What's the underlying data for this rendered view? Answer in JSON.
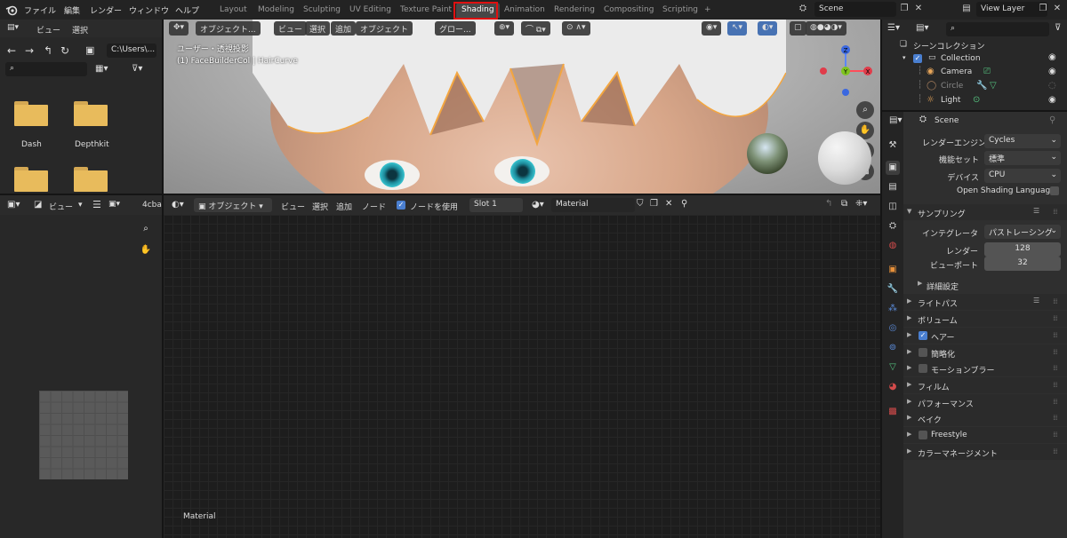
{
  "topbar": {
    "menus": [
      "ファイル",
      "編集",
      "レンダー",
      "ウィンドウ",
      "ヘルプ"
    ],
    "workspaces": [
      "Layout",
      "Modeling",
      "Sculpting",
      "UV Editing",
      "Texture Paint",
      "Shading",
      "Animation",
      "Rendering",
      "Compositing",
      "Scripting",
      "+"
    ],
    "active_workspace": "Shading",
    "scene": "Scene",
    "view_layer": "View Layer"
  },
  "filebrowser": {
    "menus": [
      "ビュー",
      "選択"
    ],
    "path": "C:\\Users\\...",
    "folders": [
      "Dash",
      "Depthkit",
      "",
      ""
    ]
  },
  "viewport": {
    "mode": "オブジェクト...",
    "menus": [
      "ビュー",
      "選択",
      "追加",
      "オブジェクト"
    ],
    "orientation": "グロー...",
    "overlay_line1": "ユーザー・透視投影",
    "overlay_line2": "(1) FaceBuilderCol | HairCurve",
    "gizmo": {
      "z": "Z",
      "x": "X",
      "y": "Y"
    }
  },
  "image_editor": {
    "menu": "ビュー",
    "image_name": "4cbat"
  },
  "node_editor": {
    "mode": "オブジェクト",
    "menus": [
      "ビュー",
      "選択",
      "追加",
      "ノード"
    ],
    "use_nodes_label": "ノードを使用",
    "slot": "Slot 1",
    "material": "Material",
    "footer_label": "Material"
  },
  "outliner": {
    "title": "シーンコレクション",
    "items": [
      {
        "label": "Collection",
        "depth": 1
      },
      {
        "label": "Camera",
        "depth": 2
      },
      {
        "label": "Circle",
        "depth": 2
      },
      {
        "label": "Light",
        "depth": 2
      }
    ]
  },
  "properties": {
    "scene": "Scene",
    "render_engine_label": "レンダーエンジン",
    "render_engine": "Cycles",
    "feature_set_label": "機能セット",
    "feature_set": "標準",
    "device_label": "デバイス",
    "device": "CPU",
    "osl_label": "Open Shading Language",
    "sampling_label": "サンプリング",
    "integrator_label": "インテグレータ",
    "integrator": "パストレーシング",
    "render_label": "レンダー",
    "render_samples": "128",
    "viewport_label": "ビューポート",
    "viewport_samples": "32",
    "advanced_label": "詳細設定",
    "sections": [
      "ライトパス",
      "ボリューム",
      "ヘアー",
      "簡略化",
      "モーションブラー",
      "フィルム",
      "パフォーマンス",
      "ベイク",
      "Freestyle",
      "カラーマネージメント"
    ]
  }
}
